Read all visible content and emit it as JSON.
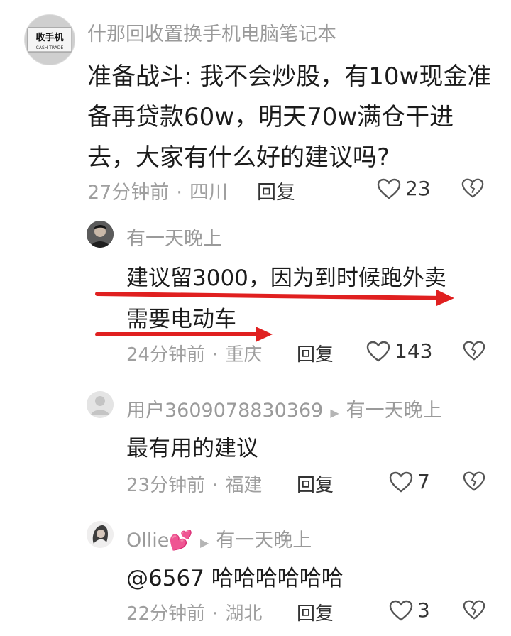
{
  "comments": [
    {
      "username": "什那回收置换手机电脑笔记本",
      "avatar_text": "收手机",
      "avatar_subtext": "CASH TRADE",
      "lines": [
        "准备战斗: 我不会炒股，有10w现金准",
        "备再贷款60w，明天70w满仓干进",
        "去，大家有什么好的建议吗?"
      ],
      "time": "27分钟前",
      "location": "四川",
      "reply_label": "回复",
      "likes": "23"
    }
  ],
  "replies": [
    {
      "username": "有一天晚上",
      "lines": [
        "建议留3000，因为到时候跑外卖",
        "需要电动车"
      ],
      "time": "24分钟前",
      "location": "重庆",
      "reply_label": "回复",
      "likes": "143"
    },
    {
      "username": "用户3609078830369",
      "reply_to": "有一天晚上",
      "lines": [
        "最有用的建议"
      ],
      "time": "23分钟前",
      "location": "福建",
      "reply_label": "回复",
      "likes": "7"
    },
    {
      "username": "Ollie💕",
      "reply_to": "有一天晚上",
      "lines": [
        "@6567 哈哈哈哈哈哈"
      ],
      "time": "22分钟前",
      "location": "湖北",
      "reply_label": "回复",
      "likes": "3"
    }
  ],
  "colors": {
    "arrow": "#e02020",
    "muted": "#9f9f9f",
    "text": "#1c1c1c"
  },
  "icons": {
    "like": "heart-outline-icon",
    "dislike": "broken-heart-icon",
    "reply_arrow": "triangle-right-icon"
  }
}
